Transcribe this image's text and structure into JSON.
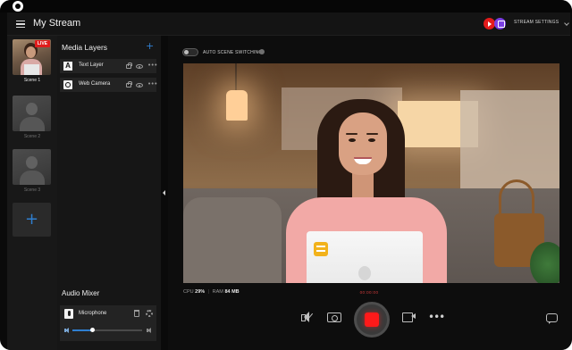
{
  "app": {
    "title": "My Stream"
  },
  "header": {
    "stream_settings_label": "STREAM SETTINGS",
    "platforms": [
      "youtube-icon",
      "twitch-icon"
    ],
    "brand_colors": {
      "youtube": "#e31b1b",
      "twitch": "#7b3fe4",
      "accent": "#2f7fd0",
      "record": "#ff1a1a"
    }
  },
  "scenes": {
    "items": [
      {
        "label": "Scene 1",
        "live_badge": "LIVE",
        "active": true
      },
      {
        "label": "Scene 2",
        "active": false
      },
      {
        "label": "Scene 3",
        "active": false
      }
    ],
    "add_icon": "+"
  },
  "media_layers": {
    "heading": "Media Layers",
    "add_icon": "+",
    "items": [
      {
        "icon_glyph": "A",
        "icon": "text-layer-icon",
        "label": "Text Layer"
      },
      {
        "icon": "webcam-icon",
        "label": "Web Camera"
      }
    ],
    "more_glyph": "•••"
  },
  "audio_mixer": {
    "heading": "Audio Mixer",
    "channel": {
      "label": "Microphone",
      "volume_fraction": 0.28
    }
  },
  "main": {
    "auto_scene_switching_label": "AUTO SCENE SWITCHING",
    "auto_scene_switching_on": false,
    "stats": {
      "cpu_label": "CPU",
      "cpu_value": "29%",
      "ram_label": "RAM",
      "ram_value": "84 MB"
    },
    "recording_status": "00:00:00",
    "controls": [
      "mute-audio-icon",
      "snapshot-icon",
      "record-button",
      "video-camera-icon",
      "more-options-icon",
      "chat-icon"
    ],
    "more_glyph": "•••"
  }
}
